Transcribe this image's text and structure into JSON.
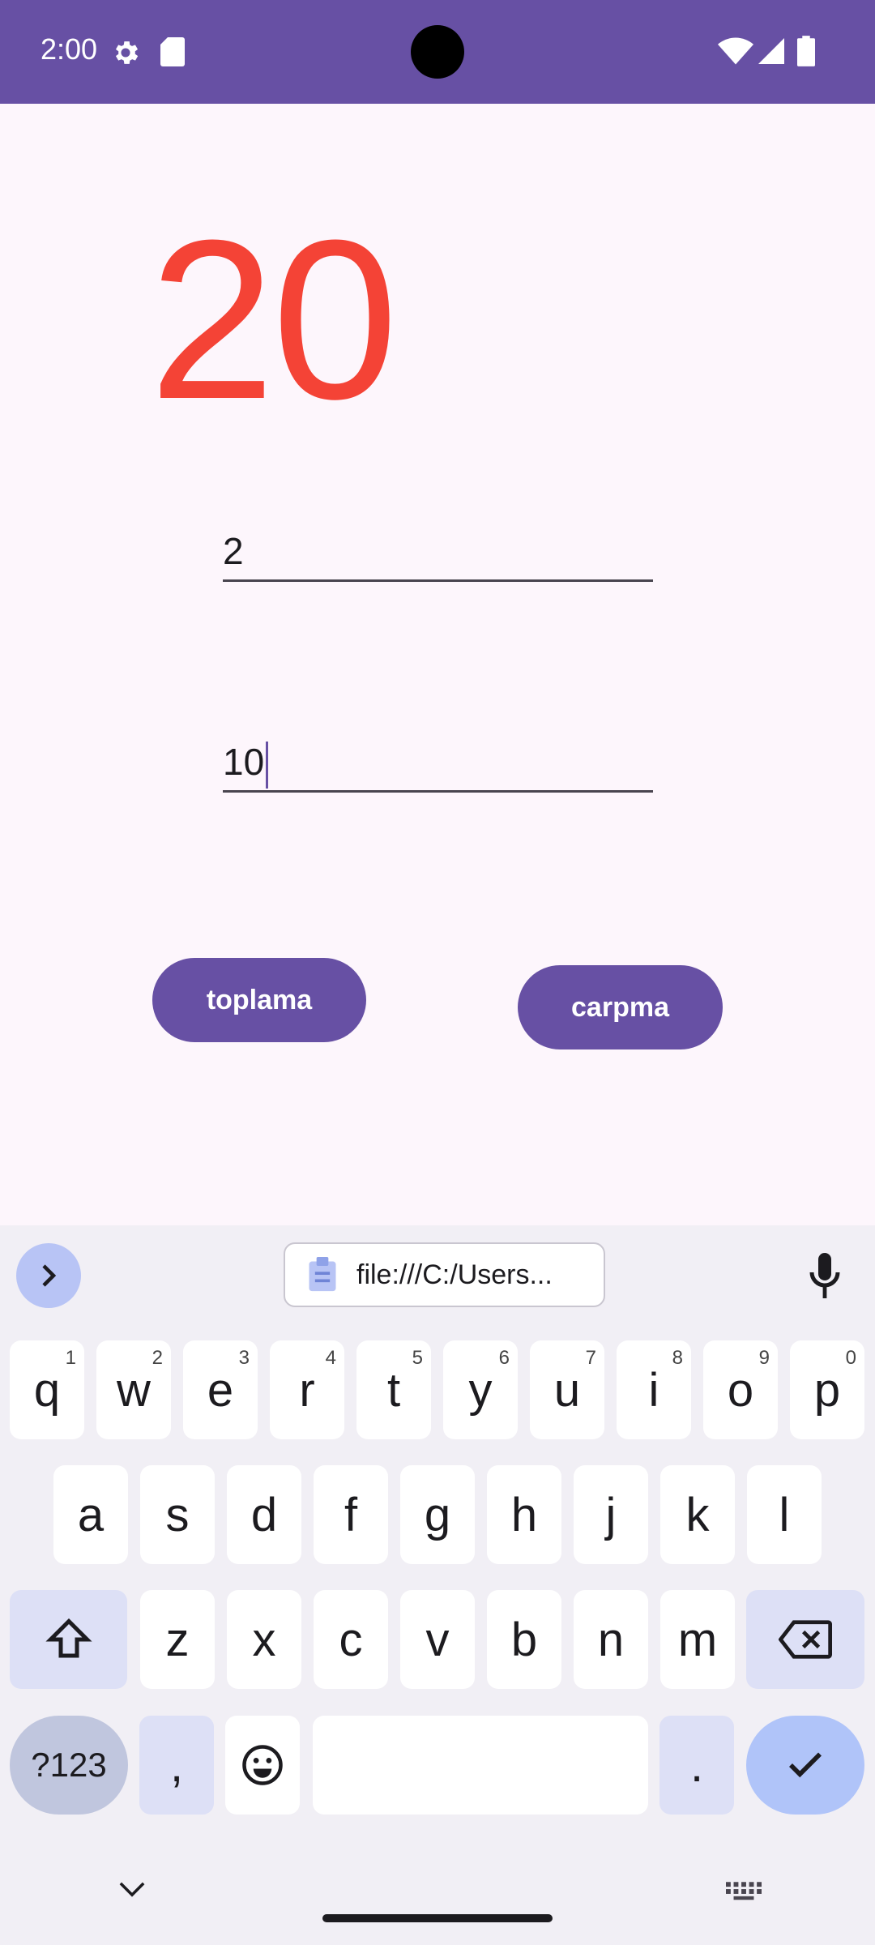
{
  "status_bar": {
    "time": "2:00",
    "bg": "#6750a4"
  },
  "app": {
    "result": "20",
    "result_color": "#f44336",
    "field1_value": "2",
    "field2_value": "10",
    "button1_label": "toplama",
    "button2_label": "carpma",
    "accent": "#6750a4"
  },
  "keyboard": {
    "clipboard_text": "file:///C:/Users...",
    "row1": [
      {
        "key": "q",
        "hint": "1"
      },
      {
        "key": "w",
        "hint": "2"
      },
      {
        "key": "e",
        "hint": "3"
      },
      {
        "key": "r",
        "hint": "4"
      },
      {
        "key": "t",
        "hint": "5"
      },
      {
        "key": "y",
        "hint": "6"
      },
      {
        "key": "u",
        "hint": "7"
      },
      {
        "key": "i",
        "hint": "8"
      },
      {
        "key": "o",
        "hint": "9"
      },
      {
        "key": "p",
        "hint": "0"
      }
    ],
    "row2": [
      "a",
      "s",
      "d",
      "f",
      "g",
      "h",
      "j",
      "k",
      "l"
    ],
    "row3": [
      "z",
      "x",
      "c",
      "v",
      "b",
      "n",
      "m"
    ],
    "symbols_label": "?123",
    "comma": ",",
    "period": "."
  },
  "icons": [
    "gear-icon",
    "sd-card-icon",
    "wifi-icon",
    "signal-icon",
    "battery-icon",
    "chevron-right-icon",
    "clipboard-icon",
    "mic-icon",
    "shift-icon",
    "backspace-icon",
    "emoji-icon",
    "check-icon",
    "chevron-down-icon",
    "keyboard-icon"
  ]
}
